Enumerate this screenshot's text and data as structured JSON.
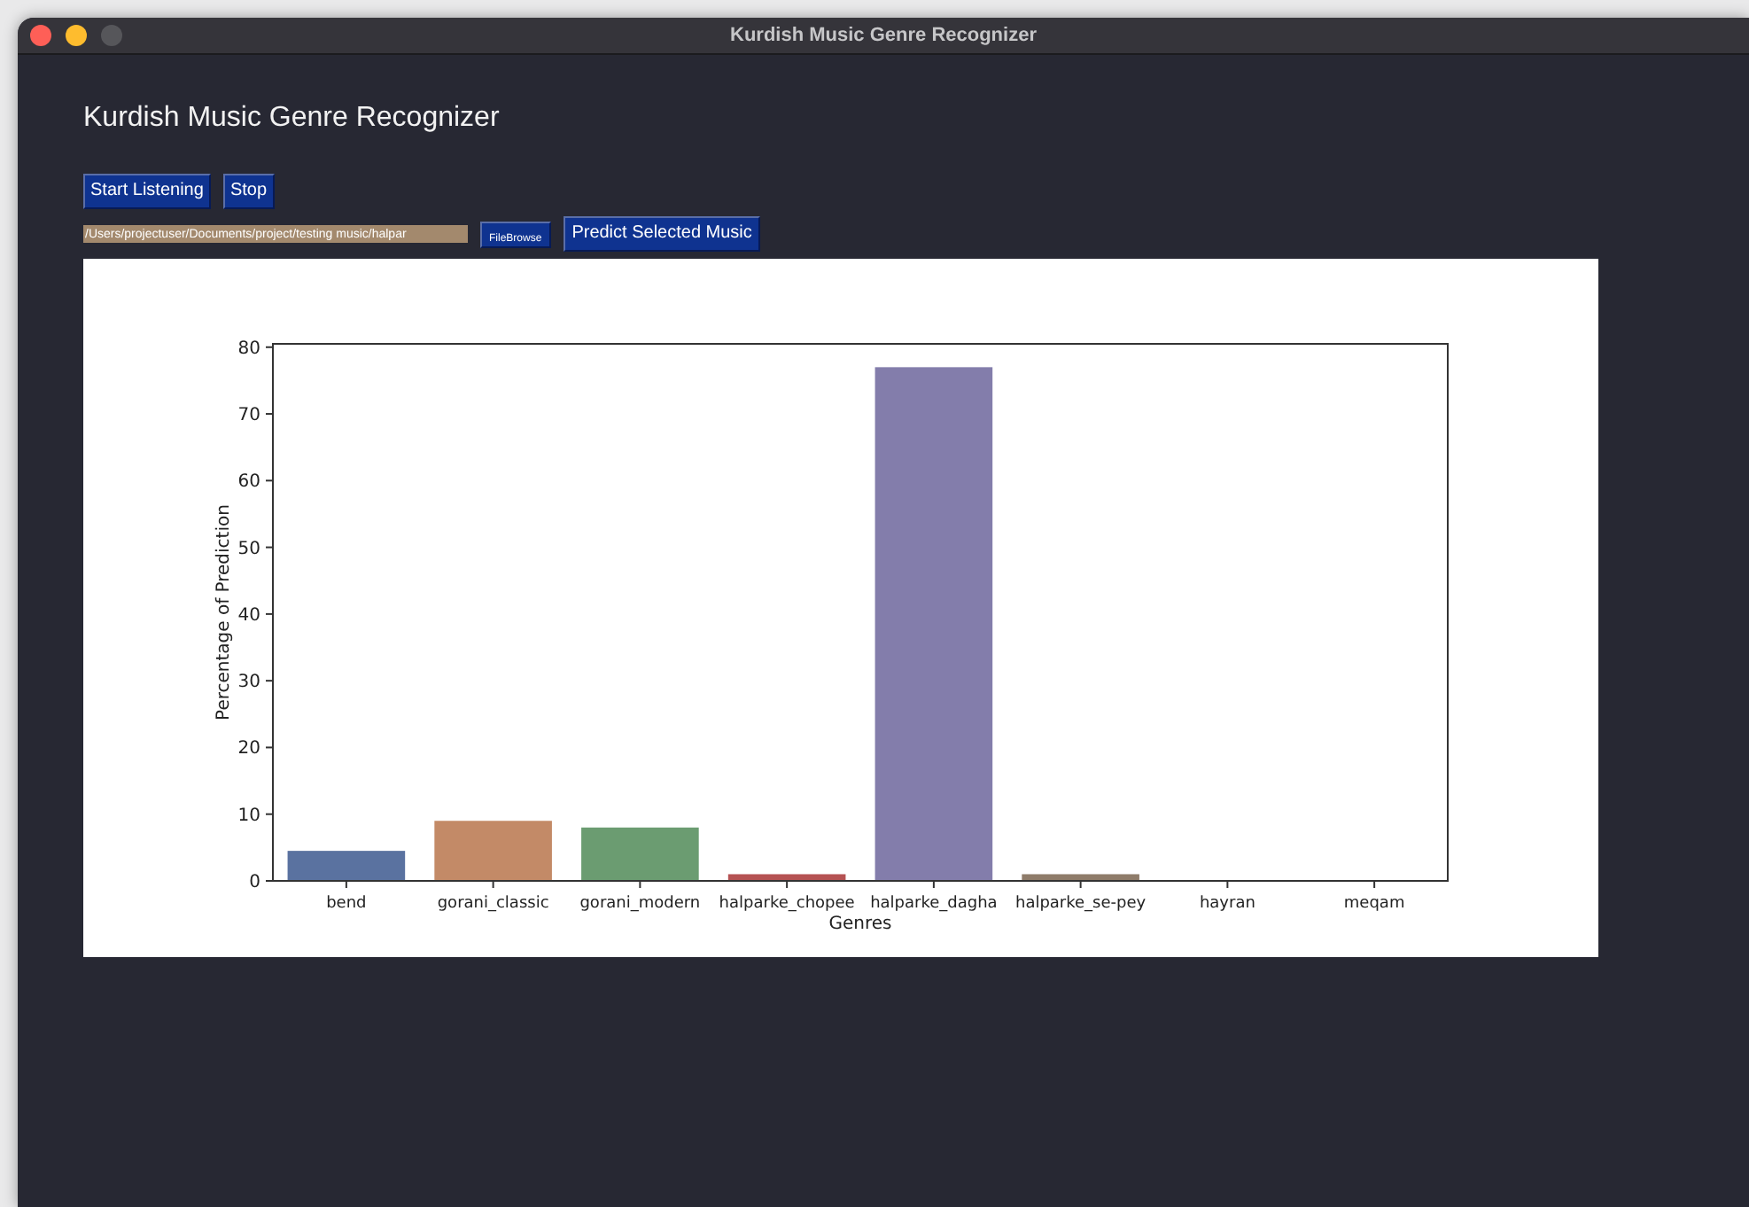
{
  "window": {
    "title": "Kurdish Music Genre Recognizer"
  },
  "heading": "Kurdish Music Genre Recognizer",
  "listen_buttons": [
    "Start Listening",
    "Stop"
  ],
  "file_row": {
    "path": "/Users/projectuser/Documents/project/testing music/halpar",
    "browse_button": "FileBrowse",
    "predict_button": "Predict Selected Music"
  },
  "chart": {
    "chart_data": {
      "type": "bar",
      "xlabel": "Genres",
      "ylabel": "Percentage of Prediction",
      "categories": [
        "bend",
        "gorani_classic",
        "gorani_modern",
        "halparke_chopee",
        "halparke_dagha",
        "halparke_se-pey",
        "hayran",
        "meqam"
      ],
      "series": [
        {
          "color": "#5a72a0",
          "values": [
            4.5,
            null,
            null,
            null,
            null,
            null,
            null,
            null
          ]
        },
        {
          "color": "#c38a67",
          "values": [
            null,
            9,
            null,
            null,
            null,
            null,
            null,
            null
          ]
        },
        {
          "color": "#6b9c71",
          "values": [
            null,
            null,
            8,
            null,
            null,
            null,
            null,
            null
          ]
        },
        {
          "color": "#b55253",
          "values": [
            null,
            null,
            null,
            1,
            null,
            null,
            null,
            null
          ]
        },
        {
          "color": "#837dab",
          "values": [
            null,
            null,
            null,
            null,
            77,
            null,
            null,
            null
          ]
        },
        {
          "color": "#8f7c6a",
          "values": [
            null,
            null,
            null,
            null,
            null,
            1,
            null,
            null
          ]
        },
        {
          "color": "#d88fbf",
          "values": [
            null,
            null,
            null,
            null,
            null,
            null,
            0,
            null
          ]
        },
        {
          "color": "#8c8c8c",
          "values": [
            null,
            null,
            null,
            null,
            null,
            null,
            null,
            0
          ]
        }
      ],
      "ylim": [
        0,
        80.5
      ],
      "yticks": [
        0,
        10,
        20,
        30,
        40,
        50,
        60,
        70,
        80
      ]
    }
  }
}
